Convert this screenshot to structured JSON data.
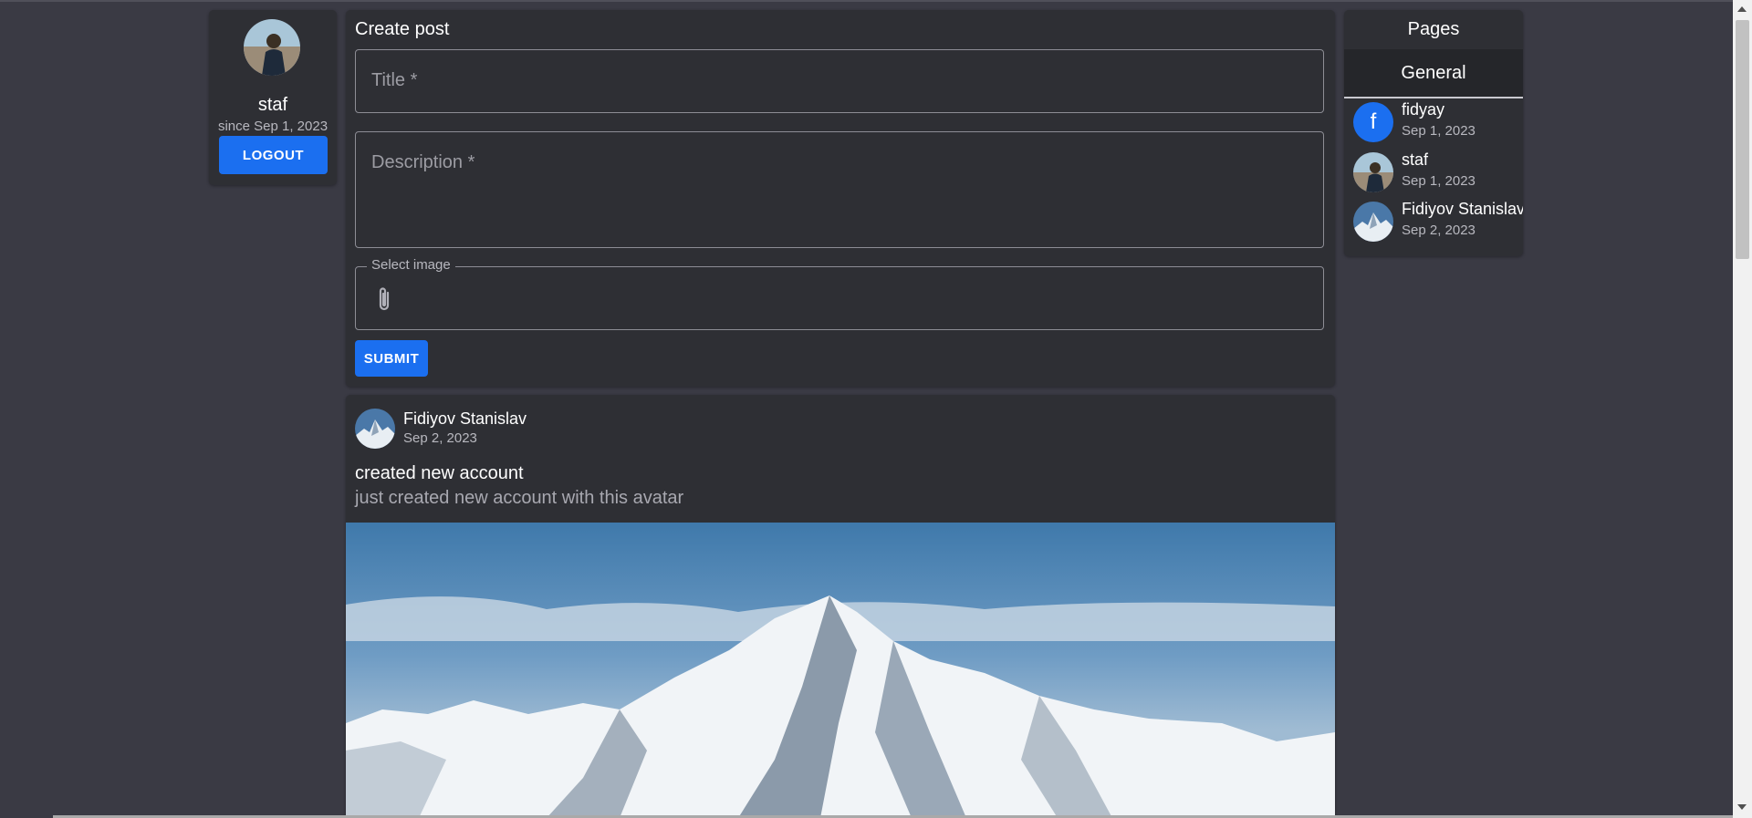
{
  "profile": {
    "username": "staf",
    "since": "since Sep 1, 2023",
    "logout_label": "LOGOUT"
  },
  "create_post": {
    "heading": "Create post",
    "title_placeholder": "Title *",
    "description_placeholder": "Description *",
    "image_label": "Select image",
    "submit_label": "SUBMIT"
  },
  "post": {
    "author": "Fidiyov Stanislav",
    "date": "Sep 2, 2023",
    "title": "created new account",
    "description": "just created new account with this avatar"
  },
  "pages": {
    "heading": "Pages",
    "tab": "General",
    "items": [
      {
        "name": "fidyay",
        "date": "Sep 1, 2023",
        "avatar_letter": "f"
      },
      {
        "name": "staf",
        "date": "Sep 1, 2023"
      },
      {
        "name": "Fidiyov Stanislav",
        "date": "Sep 2, 2023"
      }
    ]
  },
  "colors": {
    "background": "#3a3a44",
    "card": "#2e2f34",
    "accent": "#1b6ff0"
  }
}
